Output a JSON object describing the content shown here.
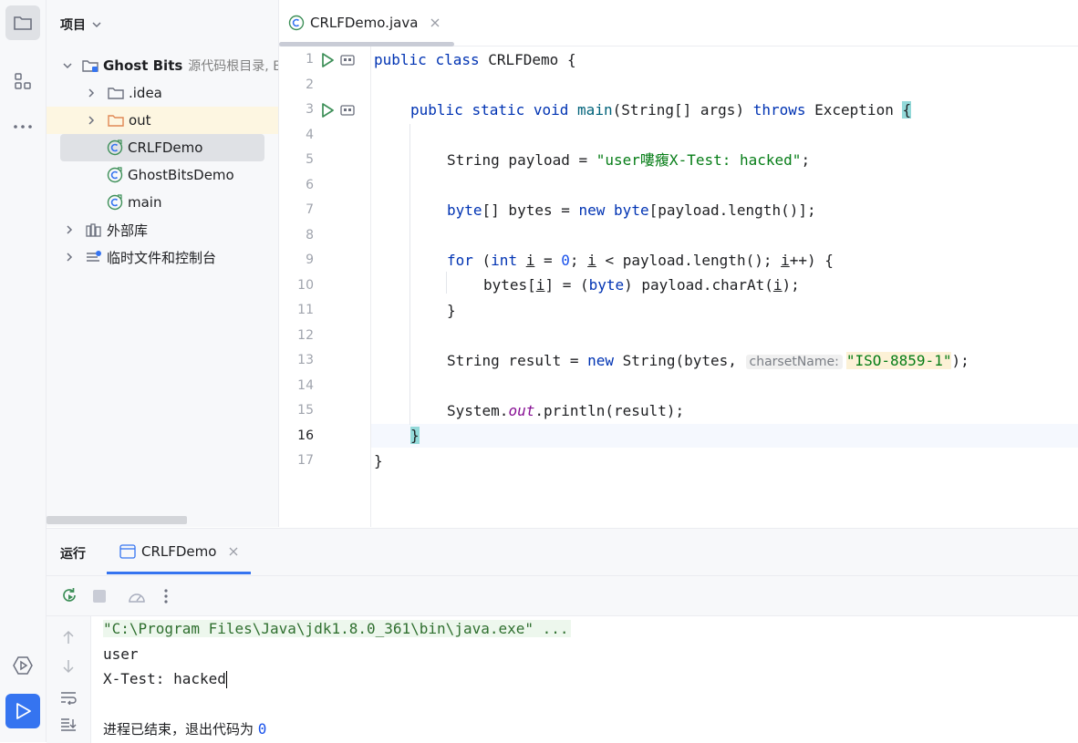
{
  "project": {
    "header": "项目",
    "tree": [
      {
        "label": "Ghost Bits",
        "note": "源代码根目录, E",
        "level": 0,
        "expanded": true,
        "icon": "module-folder-icon"
      },
      {
        "label": ".idea",
        "level": 1,
        "expanded": false,
        "icon": "folder-icon"
      },
      {
        "label": "out",
        "level": 1,
        "expanded": false,
        "icon": "folder-orange-icon"
      },
      {
        "label": "CRLFDemo",
        "level": 1,
        "icon": "java-class-icon"
      },
      {
        "label": "GhostBitsDemo",
        "level": 1,
        "icon": "java-class-icon"
      },
      {
        "label": "main",
        "level": 1,
        "icon": "java-class-icon"
      },
      {
        "label": "外部库",
        "level": 0,
        "expanded": false,
        "icon": "library-icon"
      },
      {
        "label": "临时文件和控制台",
        "level": 0,
        "expanded": false,
        "icon": "scratch-icon"
      }
    ]
  },
  "editor": {
    "tab": {
      "label": "CRLFDemo.java"
    },
    "line_numbers": [
      "1",
      "2",
      "3",
      "4",
      "5",
      "6",
      "7",
      "8",
      "9",
      "10",
      "11",
      "12",
      "13",
      "14",
      "15",
      "16",
      "17"
    ],
    "current_line": "16",
    "code": {
      "l1": {
        "kw1": "public",
        "kw2": "class",
        "rest": " CRLFDemo {"
      },
      "l3": {
        "kw1": "public",
        "kw2": "static",
        "kw3": "void",
        "fn": "main",
        "mid": "(String[] args) ",
        "kw4": "throws",
        "rest": " Exception ",
        "brace": "{"
      },
      "l5": {
        "pre": "String payload = ",
        "str": "\"user嘍癁X-Test: hacked\"",
        "post": ";"
      },
      "l7": {
        "kw1": "byte",
        "mid": "[] bytes = ",
        "kw2": "new",
        "kw3": "byte",
        "post": "[payload.length()];"
      },
      "l9": {
        "kw1": "for",
        "p1": " (",
        "kw2": "int",
        "v1": "i",
        "p2": " = ",
        "num": "0",
        "p3": "; ",
        "v2": "i",
        "p4": " < payload.length(); ",
        "v3": "i",
        "p5": "++) {"
      },
      "l10": {
        "p1": "bytes[",
        "v1": "i",
        "p2": "] = (",
        "kw1": "byte",
        "p3": ") payload.charAt(",
        "v2": "i",
        "p4": ");"
      },
      "l11": {
        "text": "}"
      },
      "l13": {
        "pre": "String result = ",
        "kw1": "new",
        "mid": " String(bytes, ",
        "hint": "charsetName:",
        "str": "\"ISO-8859-1\"",
        "post": ");"
      },
      "l15": {
        "pre": "System.",
        "fld": "out",
        "post": ".println(result);"
      },
      "l16": {
        "brace": "}"
      },
      "l17": {
        "text": "}"
      }
    }
  },
  "run": {
    "title": "运行",
    "tab": {
      "label": "CRLFDemo"
    },
    "output": {
      "cmd": "\"C:\\Program Files\\Java\\jdk1.8.0_361\\bin\\java.exe\" ...",
      "line1": "user",
      "line2": "X-Test: hacked",
      "exit": "进程已结束，退出代码为 ",
      "exit_code": "0"
    }
  },
  "colors": {
    "accent": "#3574f0",
    "keyword": "#0033b3",
    "string": "#067d17",
    "number": "#1750eb",
    "field": "#871094"
  }
}
